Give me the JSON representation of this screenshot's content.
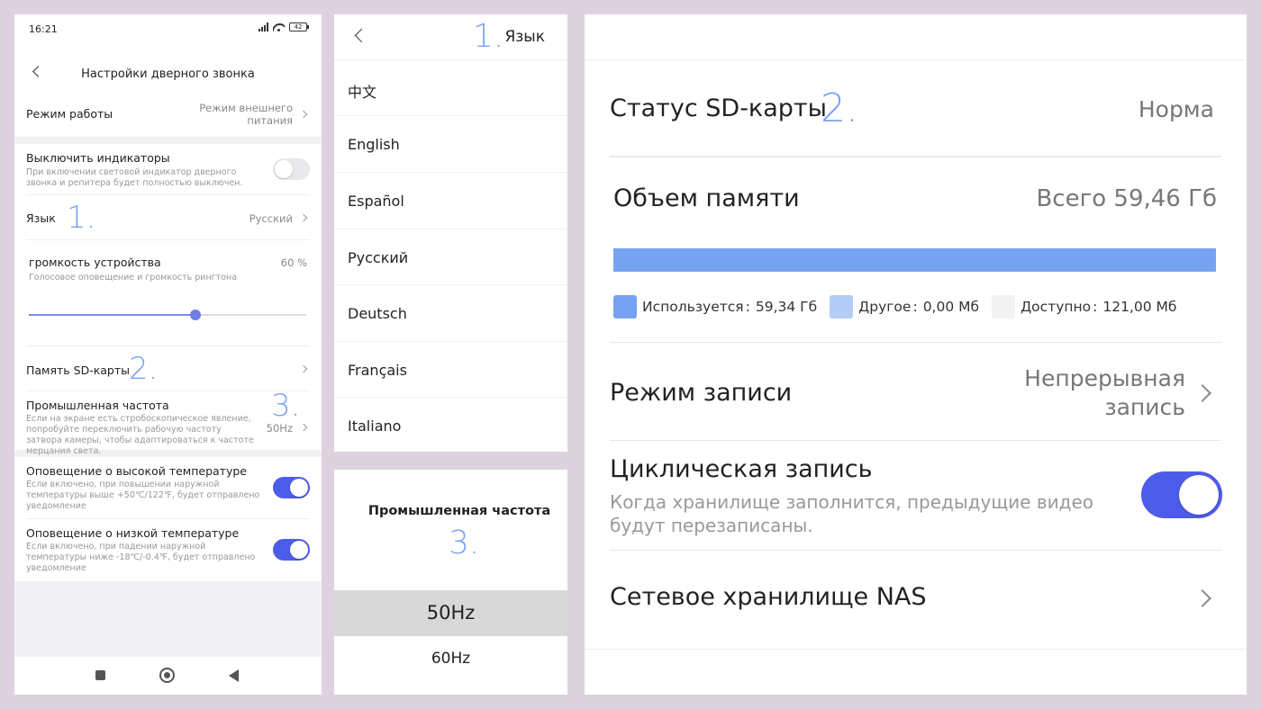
{
  "colors": {
    "accent": "#4d5ce8",
    "marker": "#7aa3f2",
    "used": "#77a2f3",
    "other": "#b4cdf7",
    "free": "#f2f2f2"
  },
  "panel1": {
    "status": {
      "time": "16:21",
      "battery": "42"
    },
    "header": {
      "title": "Настройки дверного звонка"
    },
    "mode": {
      "label": "Режим работы",
      "value_line1": "Режим внешнего",
      "value_line2": "питания"
    },
    "indicators": {
      "label": "Выключить индикаторы",
      "desc_line1": "При включении световой индикатор дверного",
      "desc_line2": "звонка и репитера будет полностью выключен.",
      "enabled": false
    },
    "language": {
      "label": "Язык",
      "value": "Русский",
      "marker": "1."
    },
    "volume": {
      "label": "громкость устройства",
      "value": "60 %",
      "desc": "Голосовое оповещение и громкость рингтона",
      "level": 0.6
    },
    "sd": {
      "label": "Память SD-карты",
      "marker": "2."
    },
    "freq": {
      "label": "Промышленная частота",
      "value": "50Hz",
      "marker": "3.",
      "desc_line1": "Если на экране есть стробоскопическое явление,",
      "desc_line2": "попробуйте переключить рабочую частоту",
      "desc_line3": "затвора камеры, чтобы адаптироваться к частоте",
      "desc_line4": "мерцания света."
    },
    "high_temp": {
      "label": "Оповещение о высокой температуре",
      "desc_line1": "Если включено, при повышении наружной",
      "desc_line2": "температуры выше +50℃/122℉, будет отправлено",
      "desc_line3": "уведомление",
      "enabled": true
    },
    "low_temp": {
      "label": "Оповещение о низкой температуре",
      "desc_line1": "Если включено, при падении наружной",
      "desc_line2": "температуры ниже -18℃/-0.4℉, будет отправлено",
      "desc_line3": "уведомление",
      "enabled": true
    },
    "navbar": {
      "icons": [
        "square-icon",
        "circle-icon",
        "triangle-back-icon"
      ]
    }
  },
  "panel2": {
    "title": "Язык",
    "marker": "1.",
    "languages": [
      "中文",
      "English",
      "Español",
      "Русский",
      "Deutsch",
      "Français",
      "Italiano"
    ]
  },
  "panel3": {
    "title": "Промышленная частота",
    "marker": "3.",
    "options": [
      "50Hz",
      "60Hz"
    ],
    "selected": "50Hz"
  },
  "panel4": {
    "sd_status": {
      "label": "Статус SD-карты",
      "marker": "2.",
      "value": "Норма"
    },
    "memory": {
      "label": "Объем памяти",
      "total": "Всего 59,46 Гб",
      "used_fraction": 1.0,
      "legend": [
        {
          "label": "Используется",
          "sep": ":",
          "value": "59,34 Гб",
          "color": "#77a2f3"
        },
        {
          "label": "Другое",
          "sep": ":",
          "value": "0,00 Мб",
          "color": "#b4cdf7"
        },
        {
          "label": "Доступно",
          "sep": ":",
          "value": "121,00 Мб",
          "color": "#f2f2f2"
        }
      ]
    },
    "record_mode": {
      "label": "Режим записи",
      "value_line1": "Непрерывная",
      "value_line2": "запись"
    },
    "loop": {
      "label": "Циклическая запись",
      "desc_line1": "Когда хранилище заполнится, предыдущие видео",
      "desc_line2": "будут перезаписаны.",
      "enabled": true
    },
    "nas": {
      "label": "Сетевое хранилище NAS"
    }
  }
}
